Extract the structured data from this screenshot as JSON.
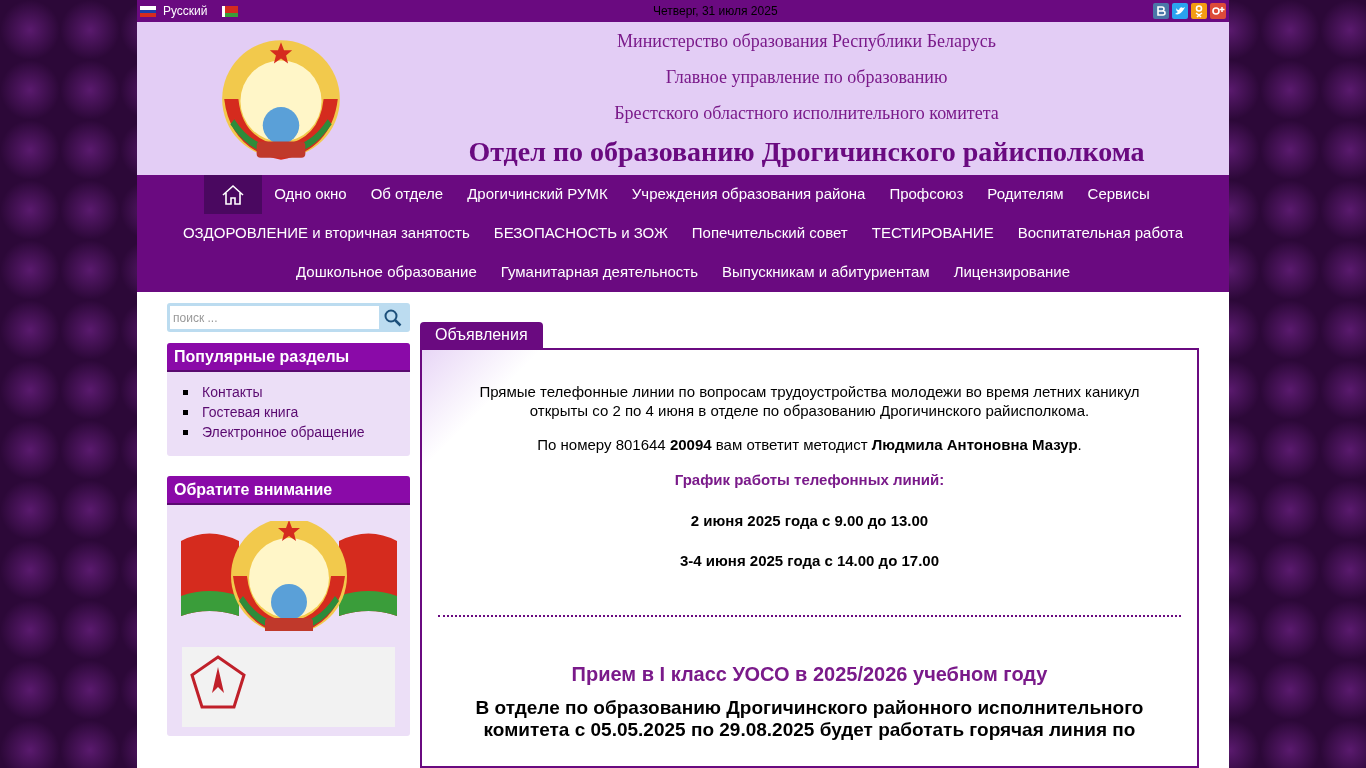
{
  "top_bar": {
    "language": "Русский",
    "date": "Четверг, 31 июля 2025"
  },
  "header": {
    "lines": [
      "Министерство образования Республики Беларусь",
      "Главное управление по образованию",
      "Брестского областного исполнительного комитета"
    ],
    "title": "Отдел по образованию Дрогичинского райисполкома"
  },
  "nav": {
    "lines": [
      {
        "items": [
          {
            "kind": "home",
            "selected": true
          },
          {
            "kind": "link",
            "label": "Одно окно",
            "selected": false
          },
          {
            "kind": "link",
            "label": "Об отделе",
            "selected": false
          },
          {
            "kind": "link",
            "label": "Дрогичинский РУМК",
            "selected": false
          },
          {
            "kind": "link",
            "label": "Учреждения образования района",
            "selected": false
          },
          {
            "kind": "link",
            "label": "Профсоюз",
            "selected": false
          },
          {
            "kind": "link",
            "label": "Родителям",
            "selected": false
          },
          {
            "kind": "link",
            "label": "Сервисы",
            "selected": false
          }
        ]
      },
      {
        "items": [
          {
            "kind": "link",
            "label": "ОЗДОРОВЛЕНИЕ и вторичная занятость",
            "selected": false
          },
          {
            "kind": "link",
            "label": "БЕЗОПАСНОСТЬ и ЗОЖ",
            "selected": false
          },
          {
            "kind": "link",
            "label": "Попечительский совет",
            "selected": false
          },
          {
            "kind": "link",
            "label": "ТЕСТИРОВАНИЕ",
            "selected": false
          },
          {
            "kind": "link",
            "label": "Воспитательная работа",
            "selected": false
          }
        ]
      },
      {
        "items": [
          {
            "kind": "link",
            "label": "Дошкольное образование",
            "selected": false
          },
          {
            "kind": "link",
            "label": "Гуманитарная деятельность",
            "selected": false
          },
          {
            "kind": "link",
            "label": "Выпускникам и абитуриентам",
            "selected": false
          },
          {
            "kind": "link",
            "label": "Лицензирование",
            "selected": false
          }
        ]
      }
    ]
  },
  "search": {
    "placeholder": "поиск ..."
  },
  "popular": {
    "title": "Популярные разделы",
    "links": [
      "Контакты",
      "Гостевая книга",
      "Электронное обращение"
    ]
  },
  "attention": {
    "title": "Обратите внимание"
  },
  "main": {
    "tab": "Объявления",
    "blocks": [
      {
        "kind": "text",
        "text": "Прямые телефонные линии по вопросам трудоустройства молодежи во время летних каникул открыты со 2 по 4 июня в отделе по образованию Дрогичинского райисполкома."
      },
      {
        "kind": "text",
        "text": "По номеру 801644 **20094** вам ответит методист **Людмила Антоновна Мазур**."
      },
      {
        "kind": "accent",
        "text": "График работы телефонных линий:"
      },
      {
        "kind": "bold",
        "text": "2 июня 2025 года с 9.00 до 13.00"
      },
      {
        "kind": "bold",
        "text": "3-4 июня 2025 года с 14.00 до 17.00"
      },
      {
        "kind": "divider"
      },
      {
        "kind": "heading",
        "text": "Прием в I класс УОСО в 2025/2026 учебном году"
      },
      {
        "kind": "lead",
        "text": "В отделе по образованию Дрогичинского районного исполнительного комитета с 05.05.2025 по 29.08.2025 будет работать горячая линия по"
      }
    ]
  }
}
